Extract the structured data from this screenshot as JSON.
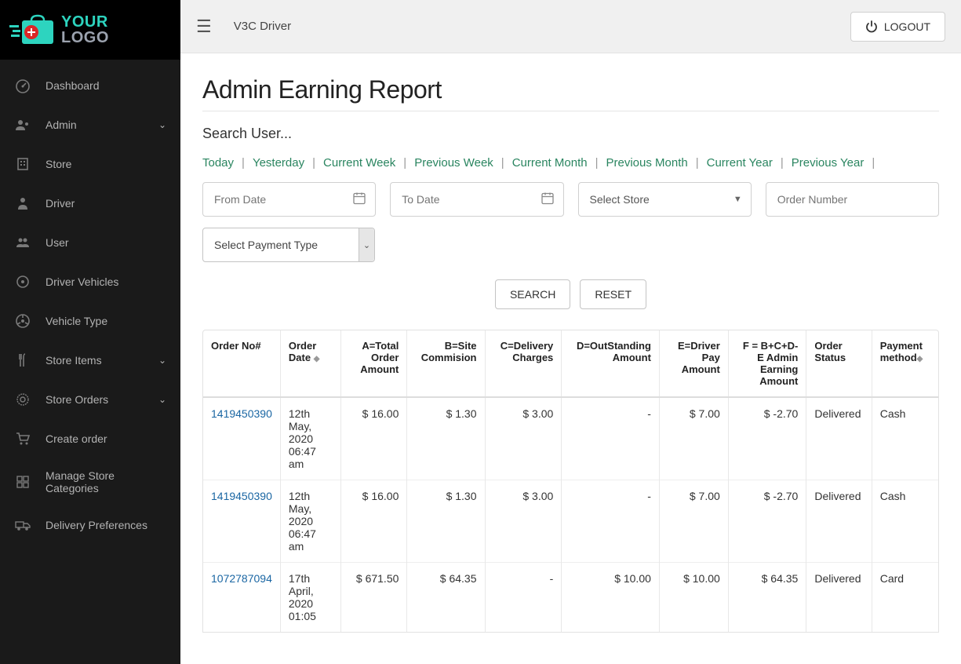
{
  "logo": {
    "line1": "YOUR",
    "line2": "LOGO"
  },
  "sidebar": {
    "items": [
      {
        "label": "Dashboard",
        "icon": "dashboard-gauge",
        "expandable": false
      },
      {
        "label": "Admin",
        "icon": "users-gear",
        "expandable": true
      },
      {
        "label": "Store",
        "icon": "building",
        "expandable": false
      },
      {
        "label": "Driver",
        "icon": "person",
        "expandable": false
      },
      {
        "label": "User",
        "icon": "people-group",
        "expandable": false
      },
      {
        "label": "Driver Vehicles",
        "icon": "target",
        "expandable": false
      },
      {
        "label": "Vehicle Type",
        "icon": "steering-wheel",
        "expandable": false
      },
      {
        "label": "Store Items",
        "icon": "utensils",
        "expandable": true
      },
      {
        "label": "Store Orders",
        "icon": "gear-badge",
        "expandable": true
      },
      {
        "label": "Create order",
        "icon": "cart",
        "expandable": false
      },
      {
        "label": "Manage Store Categories",
        "icon": "grid",
        "expandable": false
      },
      {
        "label": "Delivery Preferences",
        "icon": "truck",
        "expandable": false
      }
    ]
  },
  "topbar": {
    "title": "V3C  Driver",
    "logout": "LOGOUT"
  },
  "page": {
    "title": "Admin Earning Report",
    "search_user": "Search User...",
    "date_links": [
      "Today",
      "Yesterday",
      "Current Week",
      "Previous Week",
      "Current Month",
      "Previous Month",
      "Current Year",
      "Previous Year"
    ],
    "from_date_ph": "From Date",
    "to_date_ph": "To Date",
    "select_store_ph": "Select Store",
    "order_number_ph": "Order Number",
    "payment_type_ph": "Select Payment Type",
    "search_btn": "SEARCH",
    "reset_btn": "RESET"
  },
  "table": {
    "headers": {
      "order_no": "Order No#",
      "order_date": "Order Date",
      "total": "A=Total Order Amount",
      "commission": "B=Site Commision",
      "delivery": "C=Delivery Charges",
      "outstanding": "D=OutStanding Amount",
      "driver_pay": "E=Driver Pay Amount",
      "admin_earning": "F = B+C+D-E Admin Earning Amount",
      "status": "Order Status",
      "pay_method": "Payment method"
    },
    "rows": [
      {
        "order_no": "1419450390",
        "order_date": "12th May, 2020 06:47 am",
        "total": "$ 16.00",
        "commission": "$ 1.30",
        "delivery": "$ 3.00",
        "outstanding": "-",
        "driver_pay": "$ 7.00",
        "admin_earning": "$ -2.70",
        "status": "Delivered",
        "pay_method": "Cash"
      },
      {
        "order_no": "1419450390",
        "order_date": "12th May, 2020 06:47 am",
        "total": "$ 16.00",
        "commission": "$ 1.30",
        "delivery": "$ 3.00",
        "outstanding": "-",
        "driver_pay": "$ 7.00",
        "admin_earning": "$ -2.70",
        "status": "Delivered",
        "pay_method": "Cash"
      },
      {
        "order_no": "1072787094",
        "order_date": "17th April, 2020 01:05",
        "total": "$ 671.50",
        "commission": "$ 64.35",
        "delivery": "-",
        "outstanding": "$ 10.00",
        "driver_pay": "$ 10.00",
        "admin_earning": "$ 64.35",
        "status": "Delivered",
        "pay_method": "Card"
      }
    ]
  }
}
